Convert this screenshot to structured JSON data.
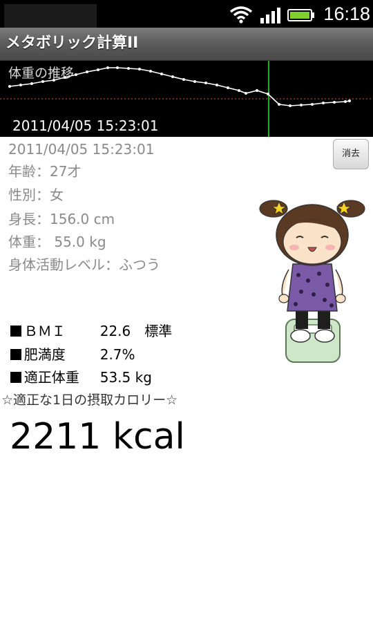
{
  "status_bar": {
    "time": "16:18",
    "icons": [
      "wifi-icon",
      "signal-icon",
      "battery-icon"
    ],
    "battery_color": "#7fd12a"
  },
  "app": {
    "title": "メタボリック計算II"
  },
  "graph": {
    "title": "体重の推移",
    "selected_date": "2011/04/05 15:23:01",
    "line_color": "#ffffff",
    "reference_line_color": "#c0392b",
    "cursor_color": "#23b023"
  },
  "record": {
    "date": "2011/04/05 15:23:01",
    "delete_label": "消去",
    "age": "年齢：27才",
    "sex": "性別：女",
    "height": "身長：156.0 cm",
    "weight": "体重： 55.0 kg",
    "activity": "身体活動レベル：ふつう"
  },
  "results": [
    {
      "label": "ＢＭＩ",
      "value": "22.6　標準"
    },
    {
      "label": "肥満度",
      "value": "2.7%"
    },
    {
      "label": "適正体重",
      "value": "53.5 kg"
    }
  ],
  "calories": {
    "label": "☆適正な1日の摂取カロリー☆",
    "value": "2211 kcal"
  }
}
